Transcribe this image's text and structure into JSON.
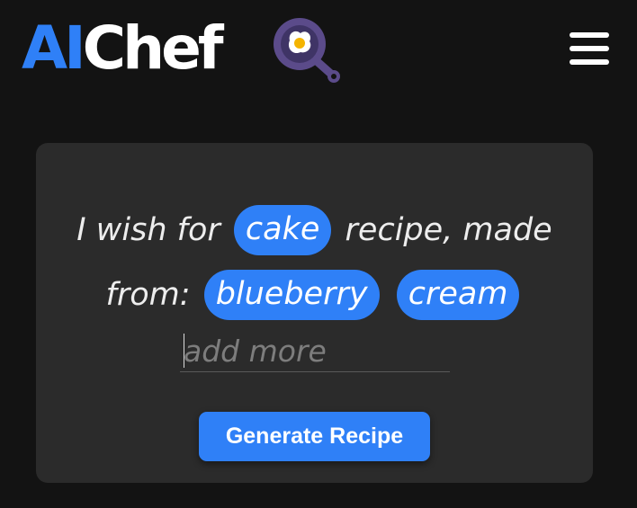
{
  "header": {
    "logo_prefix": "AI",
    "logo_suffix": "Chef",
    "logo_icon": "frying-pan-egg-icon",
    "menu_icon": "hamburger-menu-icon"
  },
  "prompt": {
    "intro": "I wish for",
    "dish": "cake",
    "middle": "recipe, made",
    "from_label": "from:",
    "ingredients": [
      "blueberry",
      "cream"
    ],
    "input_value": "",
    "input_placeholder": "add more"
  },
  "actions": {
    "generate_label": "Generate Recipe"
  },
  "colors": {
    "background": "#131313",
    "card": "#2b2b2b",
    "accent": "#2f80f7",
    "pan": "#5b4b8a"
  }
}
